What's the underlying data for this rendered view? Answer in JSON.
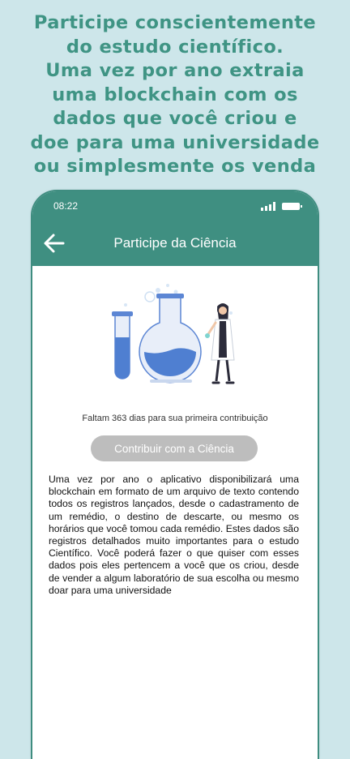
{
  "headline": {
    "lines": [
      "Participe conscientemente",
      "do estudo científico.",
      "Uma vez por ano extraia",
      "uma blockchain com os",
      "dados que você criou e",
      "doe para uma universidade",
      "ou simplesmente os venda"
    ]
  },
  "status_bar": {
    "time": "08:22"
  },
  "app_bar": {
    "title": "Participe da Ciência"
  },
  "countdown_text": "Faltam 363 dias para sua primeira contribuição",
  "contribute_button": {
    "label": "Contribuir com a Ciência"
  },
  "description": "Uma vez por ano o aplicativo disponibilizará uma blockchain em formato de um arquivo de texto contendo todos os registros lançados, desde o cadastramento de um remédio, o destino de descarte, ou mesmo os horários que você tomou cada remédio. Estes dados são registros detalhados muito importantes para o estudo Científico. Você poderá fazer o que quiser com esses dados pois eles pertencem a você que os criou, desde de vender a algum laboratório de sua escolha ou mesmo doar para uma universidade",
  "colors": {
    "background": "#cde6ea",
    "headline": "#3f9484",
    "app_bar": "#3f8f81",
    "button_disabled": "#bdbdbd",
    "flask_blue": "#4f7fd1"
  },
  "icons": [
    "back-arrow-icon",
    "signal-icon",
    "battery-icon",
    "science-illustration"
  ]
}
